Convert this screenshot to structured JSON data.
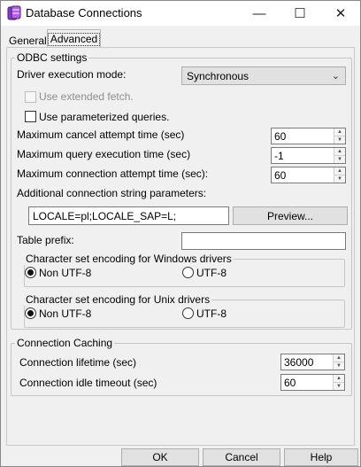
{
  "window": {
    "title": "Database Connections",
    "minimize_glyph": "—",
    "maximize_glyph": "☐",
    "close_glyph": "✕"
  },
  "tabs": [
    {
      "label": "General"
    },
    {
      "label": "Advanced"
    }
  ],
  "odbc": {
    "legend": "ODBC settings",
    "driver_mode_label": "Driver execution mode:",
    "driver_mode_value": "Synchronous",
    "use_extended_fetch": "Use extended fetch.",
    "use_parameterized": "Use parameterized queries.",
    "max_cancel_label": "Maximum cancel attempt time (sec)",
    "max_cancel_value": "60",
    "max_query_label": "Maximum query execution time (sec)",
    "max_query_value": "-1",
    "max_conn_label": "Maximum connection attempt time (sec):",
    "max_conn_value": "60",
    "additional_label": "Additional connection string parameters:",
    "additional_value": "LOCALE=pl;LOCALE_SAP=L;",
    "preview_label": "Preview...",
    "table_prefix_label": "Table prefix:",
    "table_prefix_value": ""
  },
  "charset_windows": {
    "legend": "Character set encoding for Windows drivers",
    "opt1": "Non UTF-8",
    "opt2": "UTF-8",
    "selected": "Non UTF-8"
  },
  "charset_unix": {
    "legend": "Character set encoding for Unix drivers",
    "opt1": "Non UTF-8",
    "opt2": "UTF-8",
    "selected": "Non UTF-8"
  },
  "caching": {
    "legend": "Connection Caching",
    "lifetime_label": "Connection lifetime (sec)",
    "lifetime_value": "36000",
    "idle_label": "Connection idle timeout (sec)",
    "idle_value": "60"
  },
  "buttons": {
    "ok": "OK",
    "cancel": "Cancel",
    "help": "Help"
  }
}
